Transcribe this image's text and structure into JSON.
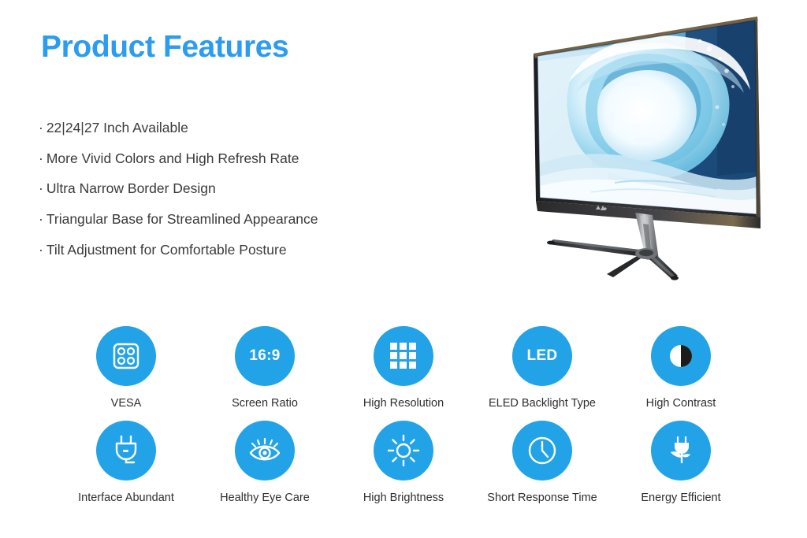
{
  "header": {
    "title": "Product Features",
    "title_color": "#2b9cf0"
  },
  "features": {
    "bullet": "·",
    "items": [
      "22|24|27 Inch Available",
      "More Vivid Colors and High Refresh Rate",
      "Ultra Narrow Border Design",
      "Triangular Base for Streamlined Appearance",
      "Tilt Adjustment for Comfortable Posture"
    ]
  },
  "product_image": {
    "name": "monitor-with-ocean-wave-wallpaper",
    "wallpaper": "ocean-wave",
    "colors": {
      "deep_sea": "#1b4a78",
      "mid_sea": "#2f7fb5",
      "cyan": "#57c2e8",
      "foam": "#ffffff",
      "bezel": "#2a2a2c",
      "stand_metal": "#9a9da1",
      "stand_dark": "#3a3c3e"
    }
  },
  "icons": {
    "circle_color": "#22a3e8",
    "rows": [
      [
        {
          "label": "VESA",
          "icon": "vesa-mount-icon",
          "text": ""
        },
        {
          "label": "Screen Ratio",
          "icon": "aspect-ratio-icon",
          "text": "16:9"
        },
        {
          "label": "High Resolution",
          "icon": "pixel-grid-icon",
          "text": ""
        },
        {
          "label": "ELED Backlight Type",
          "icon": "led-text-icon",
          "text": "LED"
        },
        {
          "label": "High Contrast",
          "icon": "contrast-circle-icon",
          "text": ""
        }
      ],
      [
        {
          "label": "Interface Abundant",
          "icon": "power-plug-icon",
          "text": ""
        },
        {
          "label": "Healthy Eye Care",
          "icon": "eye-care-icon",
          "text": ""
        },
        {
          "label": "High Brightness",
          "icon": "sun-brightness-icon",
          "text": ""
        },
        {
          "label": "Short Response Time",
          "icon": "clock-icon",
          "text": ""
        },
        {
          "label": "Energy Efficient",
          "icon": "eco-plug-leaf-icon",
          "text": ""
        }
      ]
    ]
  }
}
